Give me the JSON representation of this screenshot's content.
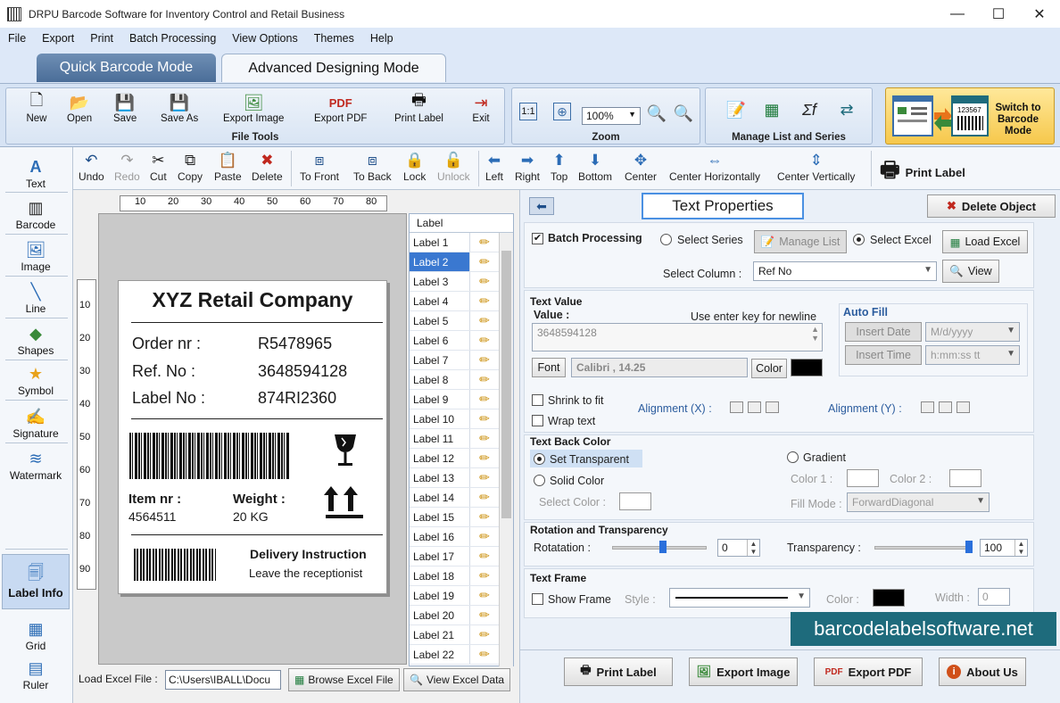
{
  "window": {
    "title": "DRPU Barcode Software for Inventory Control and Retail Business",
    "min_glyph": "—",
    "max_glyph": "☐",
    "close_glyph": "✕"
  },
  "menu": [
    "File",
    "Export",
    "Print",
    "Batch Processing",
    "View Options",
    "Themes",
    "Help"
  ],
  "mode_tabs": {
    "quick": "Quick Barcode Mode",
    "advanced": "Advanced Designing Mode"
  },
  "ribbon": {
    "file_tools_title": "File Tools",
    "file_tools": [
      "New",
      "Open",
      "Save",
      "Save As",
      "Export Image",
      "Export PDF",
      "Print Label",
      "Exit"
    ],
    "zoom_title": "Zoom",
    "zoom_value": "100%",
    "manage_title": "Manage List and Series",
    "switch_label": "Switch to Barcode Mode",
    "switch_sample": "123567"
  },
  "edit_tools": [
    "Undo",
    "Redo",
    "Cut",
    "Copy",
    "Paste",
    "Delete",
    "To Front",
    "To Back",
    "Lock",
    "Unlock",
    "Left",
    "Right",
    "Top",
    "Bottom",
    "Center",
    "Center Horizontally",
    "Center Vertically"
  ],
  "print_label": "Print Label",
  "left_tools": [
    "Text",
    "Barcode",
    "Image",
    "Line",
    "Shapes",
    "Symbol",
    "Signature",
    "Watermark",
    "Label Info",
    "Grid",
    "Ruler"
  ],
  "rulers": {
    "h_ticks": [
      "10",
      "20",
      "30",
      "40",
      "50",
      "60",
      "70",
      "80"
    ],
    "v_ticks": [
      "10",
      "20",
      "30",
      "40",
      "50",
      "60",
      "70",
      "80",
      "90"
    ]
  },
  "label_design": {
    "company": "XYZ Retail Company",
    "rows": [
      {
        "key": "Order nr :",
        "value": "R5478965"
      },
      {
        "key": "Ref. No :",
        "value": "3648594128"
      },
      {
        "key": "Label No :",
        "value": "874RI2360"
      }
    ],
    "item_label": "Item nr :",
    "item_value": "4564511",
    "weight_label": "Weight :",
    "weight_value": "20 KG",
    "delivery_title": "Delivery Instruction",
    "delivery_text": "Leave the receptionist"
  },
  "label_list": {
    "header": "Label",
    "items": [
      "Label 1",
      "Label 2",
      "Label 3",
      "Label 4",
      "Label 5",
      "Label 6",
      "Label 7",
      "Label 8",
      "Label 9",
      "Label 10",
      "Label 11",
      "Label 12",
      "Label 13",
      "Label 14",
      "Label 15",
      "Label 16",
      "Label 17",
      "Label 18",
      "Label 19",
      "Label 20",
      "Label 21",
      "Label 22"
    ],
    "selected": "Label 2"
  },
  "excel_bar": {
    "label": "Load Excel File :",
    "path": "C:\\Users\\IBALL\\Docu",
    "browse": "Browse Excel File",
    "view": "View Excel Data"
  },
  "properties": {
    "title": "Text Properties",
    "delete": "Delete Object",
    "batch_processing": "Batch Processing",
    "select_series": "Select Series",
    "manage_list": "Manage List",
    "select_excel": "Select Excel",
    "load_excel": "Load Excel",
    "select_column_label": "Select Column :",
    "select_column_value": "Ref No",
    "view": "View",
    "text_value_title": "Text Value",
    "value_label": "Value :",
    "newline_hint": "Use enter key for newline",
    "value": "3648594128",
    "font_button": "Font",
    "font_value": "Calibri , 14.25",
    "color_button": "Color",
    "text_color": "#000000",
    "auto_fill_title": "Auto Fill",
    "insert_date": "Insert Date",
    "date_format": "M/d/yyyy",
    "insert_time": "Insert Time",
    "time_format": "h:mm:ss tt",
    "shrink_to_fit": "Shrink to fit",
    "wrap_text": "Wrap text",
    "alignment_x": "Alignment (X) :",
    "alignment_y": "Alignment (Y) :",
    "back_color_title": "Text Back Color",
    "set_transparent": "Set Transparent",
    "solid_color": "Solid Color",
    "select_color": "Select Color :",
    "gradient": "Gradient",
    "color1": "Color 1 :",
    "color2": "Color 2 :",
    "fill_mode_label": "Fill Mode :",
    "fill_mode_value": "ForwardDiagonal",
    "rotation_title": "Rotation and Transparency",
    "rotation_label": "Rotatation :",
    "rotation_value": "0",
    "transparency_label": "Transparency :",
    "transparency_value": "100",
    "frame_title": "Text Frame",
    "show_frame": "Show Frame",
    "style_label": "Style :",
    "frame_color_label": "Color :",
    "frame_color": "#000000",
    "width_label": "Width :",
    "width_value": "0"
  },
  "bottom_buttons": [
    "Print Label",
    "Export Image",
    "Export PDF",
    "About Us"
  ],
  "watermark": "barcodelabelsoftware.net"
}
